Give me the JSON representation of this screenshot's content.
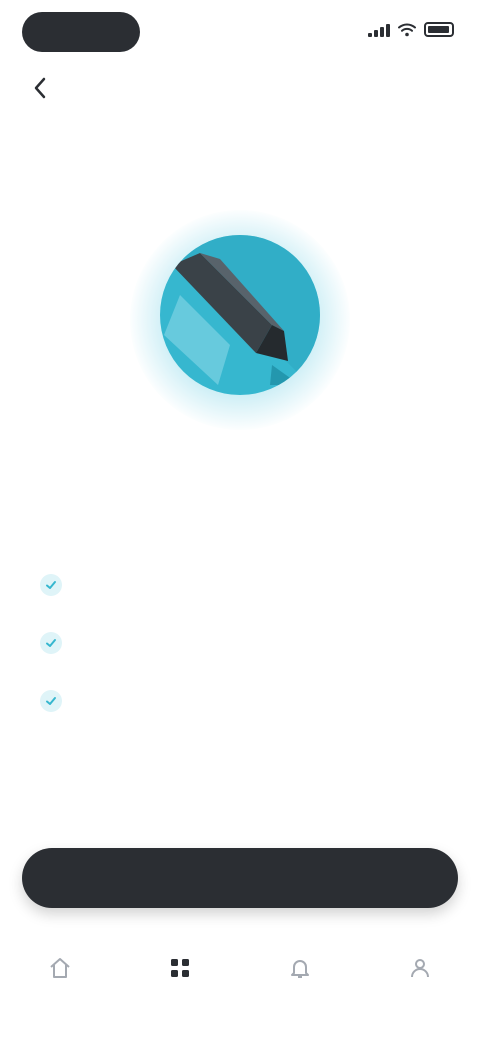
{
  "status_bar": {
    "time": "",
    "icons": [
      "signal-icon",
      "wifi-icon",
      "battery-icon"
    ]
  },
  "header": {
    "back_icon": "chevron-left-icon",
    "title": ""
  },
  "stepper": {
    "steps": [
      {
        "label": ""
      },
      {
        "label": ""
      },
      {
        "label": "",
        "active": true
      }
    ]
  },
  "hero": {
    "icon": "rocket-icon",
    "accent_color": "#36b7cf",
    "headline": "",
    "description": ""
  },
  "features": [
    {
      "icon": "check-icon",
      "text": ""
    },
    {
      "icon": "check-icon",
      "text": ""
    },
    {
      "icon": "check-icon",
      "text": ""
    }
  ],
  "cta": {
    "label": ""
  },
  "bottom_nav": {
    "items": [
      {
        "icon": "home-icon",
        "label": ""
      },
      {
        "icon": "grid-icon",
        "label": "",
        "active": true
      },
      {
        "icon": "bell-icon",
        "label": ""
      },
      {
        "icon": "user-icon",
        "label": ""
      }
    ]
  },
  "colors": {
    "primary_dark": "#2b2e33",
    "accent": "#36b7cf",
    "muted_text": "#9aa0a8"
  }
}
